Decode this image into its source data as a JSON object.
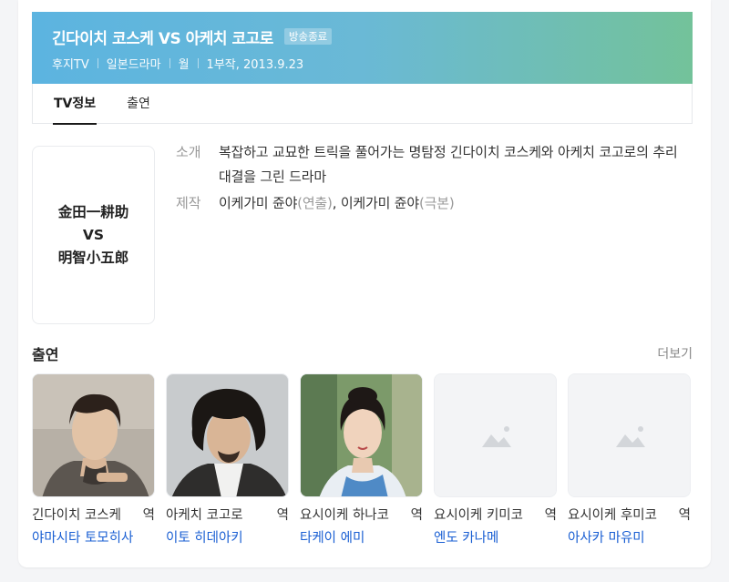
{
  "header": {
    "title": "긴다이치 코스케 VS 아케치 코고로",
    "badge": "방송종료",
    "meta": [
      "후지TV",
      "일본드라마",
      "월",
      "1부작, 2013.9.23"
    ]
  },
  "tabs": [
    {
      "label": "TV정보",
      "active": true
    },
    {
      "label": "출연",
      "active": false
    }
  ],
  "poster": {
    "lines": [
      "金田一耕助",
      "VS",
      "明智小五郎"
    ]
  },
  "info": {
    "intro_label": "소개",
    "intro_text": "복잡하고 교묘한 트릭을 풀어가는 명탐정 긴다이치 코스케와 아케치 코고로의 추리 대결을 그린 드라마",
    "production_label": "제작",
    "director": "이케가미 쥰야",
    "director_role": "(연출)",
    "writer": "이케가미 쥰야",
    "writer_role": "(극본)"
  },
  "cast": {
    "title": "출연",
    "more": "더보기",
    "role_suffix": "역",
    "items": [
      {
        "role": "긴다이치 코스케",
        "actor": "야마시타 토모히사",
        "photo": "portrait-man-short-hair"
      },
      {
        "role": "아케치 코고로",
        "actor": "이토 히데아키",
        "photo": "portrait-man-curly-hair"
      },
      {
        "role": "요시이케 하나코",
        "actor": "타케이 에미",
        "photo": "portrait-woman-kimono"
      },
      {
        "role": "요시이케 키미코",
        "actor": "엔도 카나메",
        "photo": "placeholder-image-icon"
      },
      {
        "role": "요시이케 후미코",
        "actor": "아사카 마유미",
        "photo": "placeholder-image-icon"
      }
    ]
  },
  "colors": {
    "header_gradient_start": "#5cb4e0",
    "header_gradient_end": "#73c29a",
    "actor_link": "#1a5fd3"
  }
}
